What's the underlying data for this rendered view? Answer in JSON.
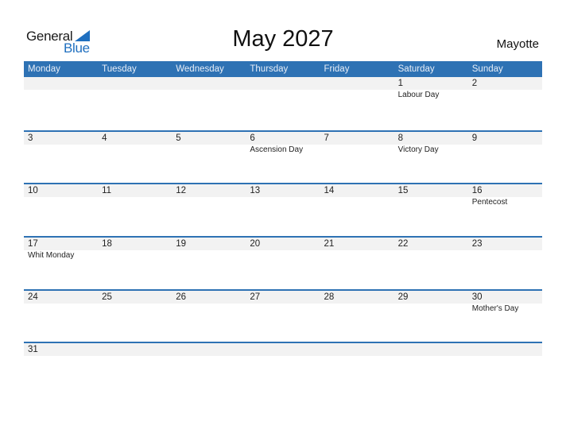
{
  "logo": {
    "text_top": "General",
    "text_bottom": "Blue"
  },
  "title": "May 2027",
  "country": "Mayotte",
  "colors": {
    "accent": "#2e72b4",
    "date_strip": "#f2f2f2",
    "logo_blue": "#1f6fbf"
  },
  "weekdays": [
    "Monday",
    "Tuesday",
    "Wednesday",
    "Thursday",
    "Friday",
    "Saturday",
    "Sunday"
  ],
  "weeks": [
    [
      {
        "day": "",
        "holiday": ""
      },
      {
        "day": "",
        "holiday": ""
      },
      {
        "day": "",
        "holiday": ""
      },
      {
        "day": "",
        "holiday": ""
      },
      {
        "day": "",
        "holiday": ""
      },
      {
        "day": "1",
        "holiday": "Labour Day"
      },
      {
        "day": "2",
        "holiday": ""
      }
    ],
    [
      {
        "day": "3",
        "holiday": ""
      },
      {
        "day": "4",
        "holiday": ""
      },
      {
        "day": "5",
        "holiday": ""
      },
      {
        "day": "6",
        "holiday": "Ascension Day"
      },
      {
        "day": "7",
        "holiday": ""
      },
      {
        "day": "8",
        "holiday": "Victory Day"
      },
      {
        "day": "9",
        "holiday": ""
      }
    ],
    [
      {
        "day": "10",
        "holiday": ""
      },
      {
        "day": "11",
        "holiday": ""
      },
      {
        "day": "12",
        "holiday": ""
      },
      {
        "day": "13",
        "holiday": ""
      },
      {
        "day": "14",
        "holiday": ""
      },
      {
        "day": "15",
        "holiday": ""
      },
      {
        "day": "16",
        "holiday": "Pentecost"
      }
    ],
    [
      {
        "day": "17",
        "holiday": "Whit Monday"
      },
      {
        "day": "18",
        "holiday": ""
      },
      {
        "day": "19",
        "holiday": ""
      },
      {
        "day": "20",
        "holiday": ""
      },
      {
        "day": "21",
        "holiday": ""
      },
      {
        "day": "22",
        "holiday": ""
      },
      {
        "day": "23",
        "holiday": ""
      }
    ],
    [
      {
        "day": "24",
        "holiday": ""
      },
      {
        "day": "25",
        "holiday": ""
      },
      {
        "day": "26",
        "holiday": ""
      },
      {
        "day": "27",
        "holiday": ""
      },
      {
        "day": "28",
        "holiday": ""
      },
      {
        "day": "29",
        "holiday": ""
      },
      {
        "day": "30",
        "holiday": "Mother's Day"
      }
    ],
    [
      {
        "day": "31",
        "holiday": ""
      },
      {
        "day": "",
        "holiday": ""
      },
      {
        "day": "",
        "holiday": ""
      },
      {
        "day": "",
        "holiday": ""
      },
      {
        "day": "",
        "holiday": ""
      },
      {
        "day": "",
        "holiday": ""
      },
      {
        "day": "",
        "holiday": ""
      }
    ]
  ]
}
